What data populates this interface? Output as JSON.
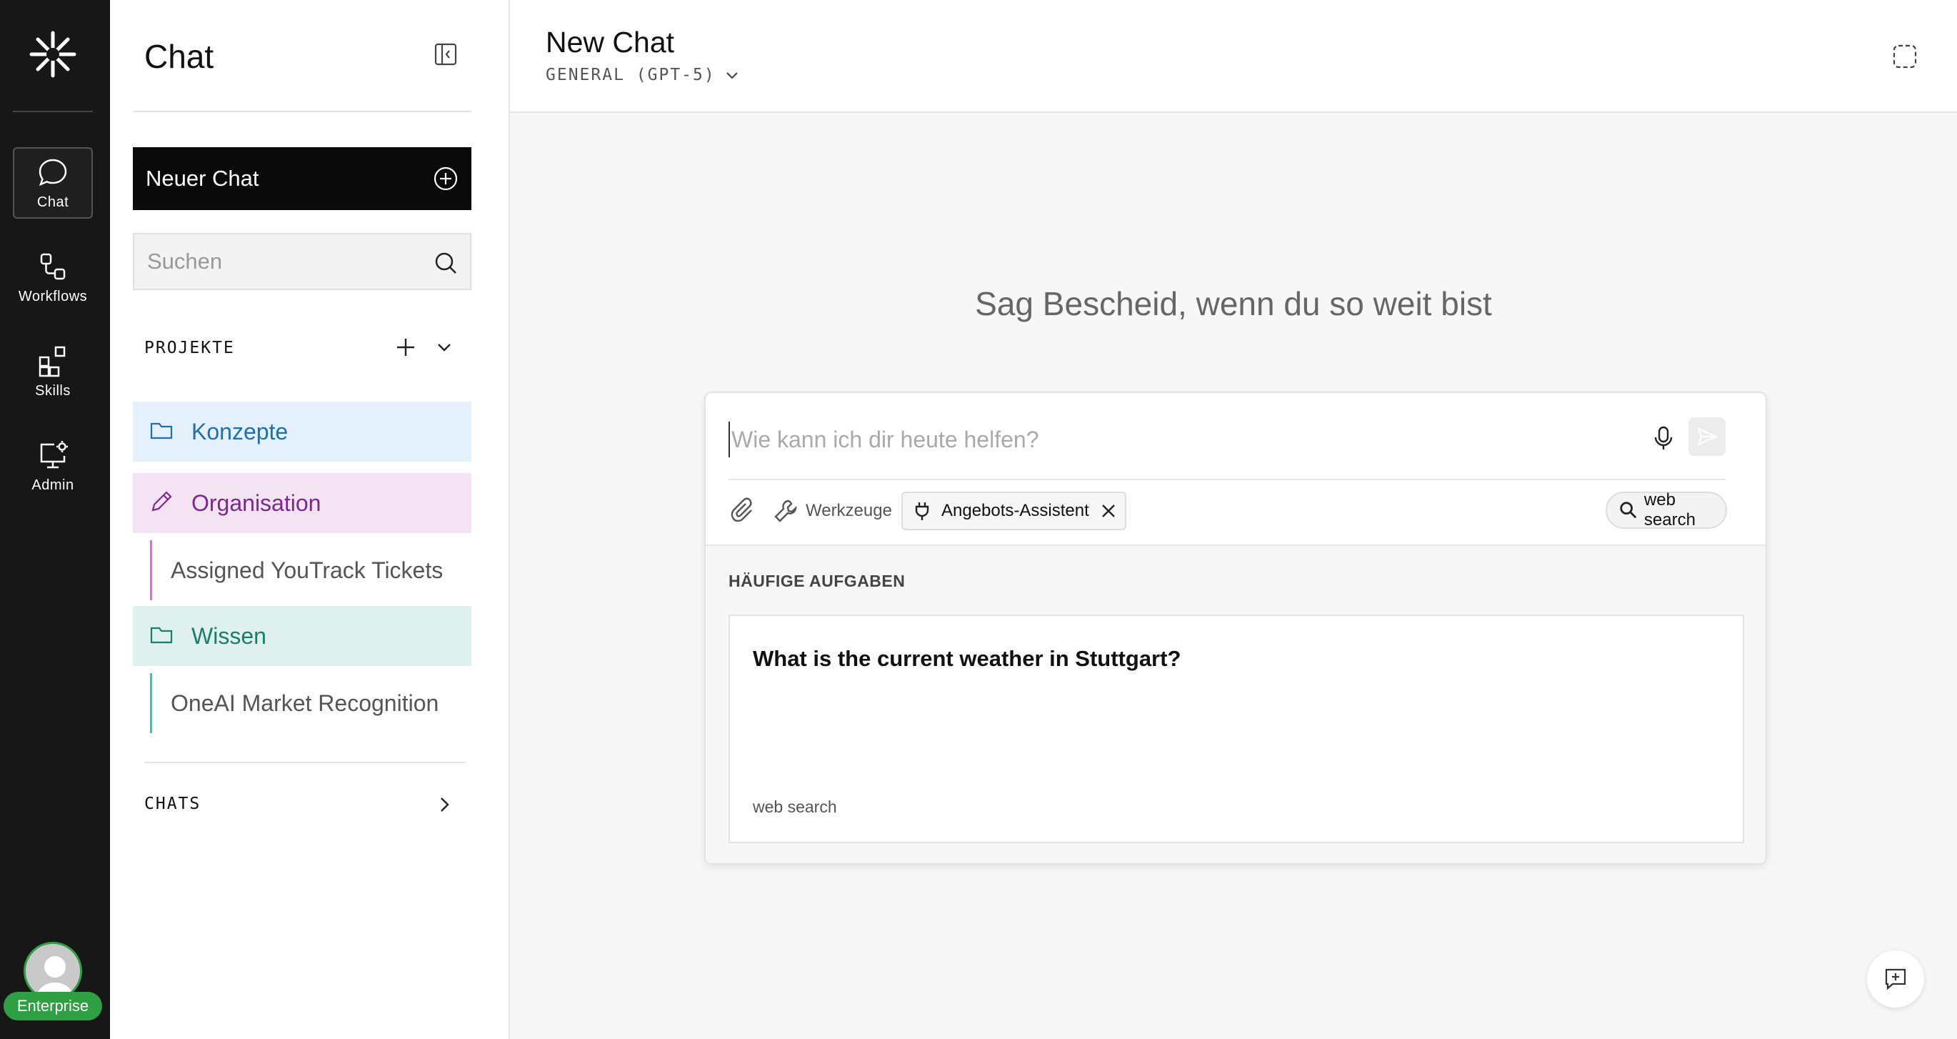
{
  "rail": {
    "items": [
      {
        "label": "Chat",
        "icon": "chat-bubble-icon",
        "active": true
      },
      {
        "label": "Workflows",
        "icon": "workflow-icon",
        "active": false
      },
      {
        "label": "Skills",
        "icon": "skills-grid-icon",
        "active": false
      },
      {
        "label": "Admin",
        "icon": "admin-monitor-icon",
        "active": false
      }
    ],
    "badge": "Enterprise"
  },
  "sidebar": {
    "title": "Chat",
    "new_chat_label": "Neuer Chat",
    "search_placeholder": "Suchen",
    "projects_label": "PROJEKTE",
    "projects": [
      {
        "label": "Konzepte",
        "icon": "folder-icon",
        "color": "#1f6fb5",
        "bg": "#e4f0fb"
      },
      {
        "label": "Organisation",
        "icon": "pencil-icon",
        "color": "#7a2a8e",
        "bg": "#f4e3f3"
      },
      {
        "label": "Wissen",
        "icon": "folder-icon",
        "color": "#1b7d6b",
        "bg": "#def1ee"
      }
    ],
    "subitems": {
      "organisation": "Assigned YouTrack Tickets",
      "wissen": "OneAI Market Recognition"
    },
    "chats_label": "CHATS"
  },
  "main": {
    "title": "New Chat",
    "model": "GENERAL (GPT-5)",
    "headline": "Sag Bescheid, wenn du so weit bist",
    "prompt_placeholder": "Wie kann ich dir heute helfen?",
    "tools_label": "Werkzeuge",
    "assistant_chip": "Angebots-Assistent",
    "web_search_label": "web search",
    "tasks_label": "HÄUFIGE AUFGABEN",
    "task": {
      "question": "What is the current weather in Stuttgart?",
      "tag": "web search"
    }
  },
  "colors": {
    "rail_bg": "#171717",
    "accent_green": "#2ea043",
    "new_chat_bg": "#0a0a0a"
  }
}
